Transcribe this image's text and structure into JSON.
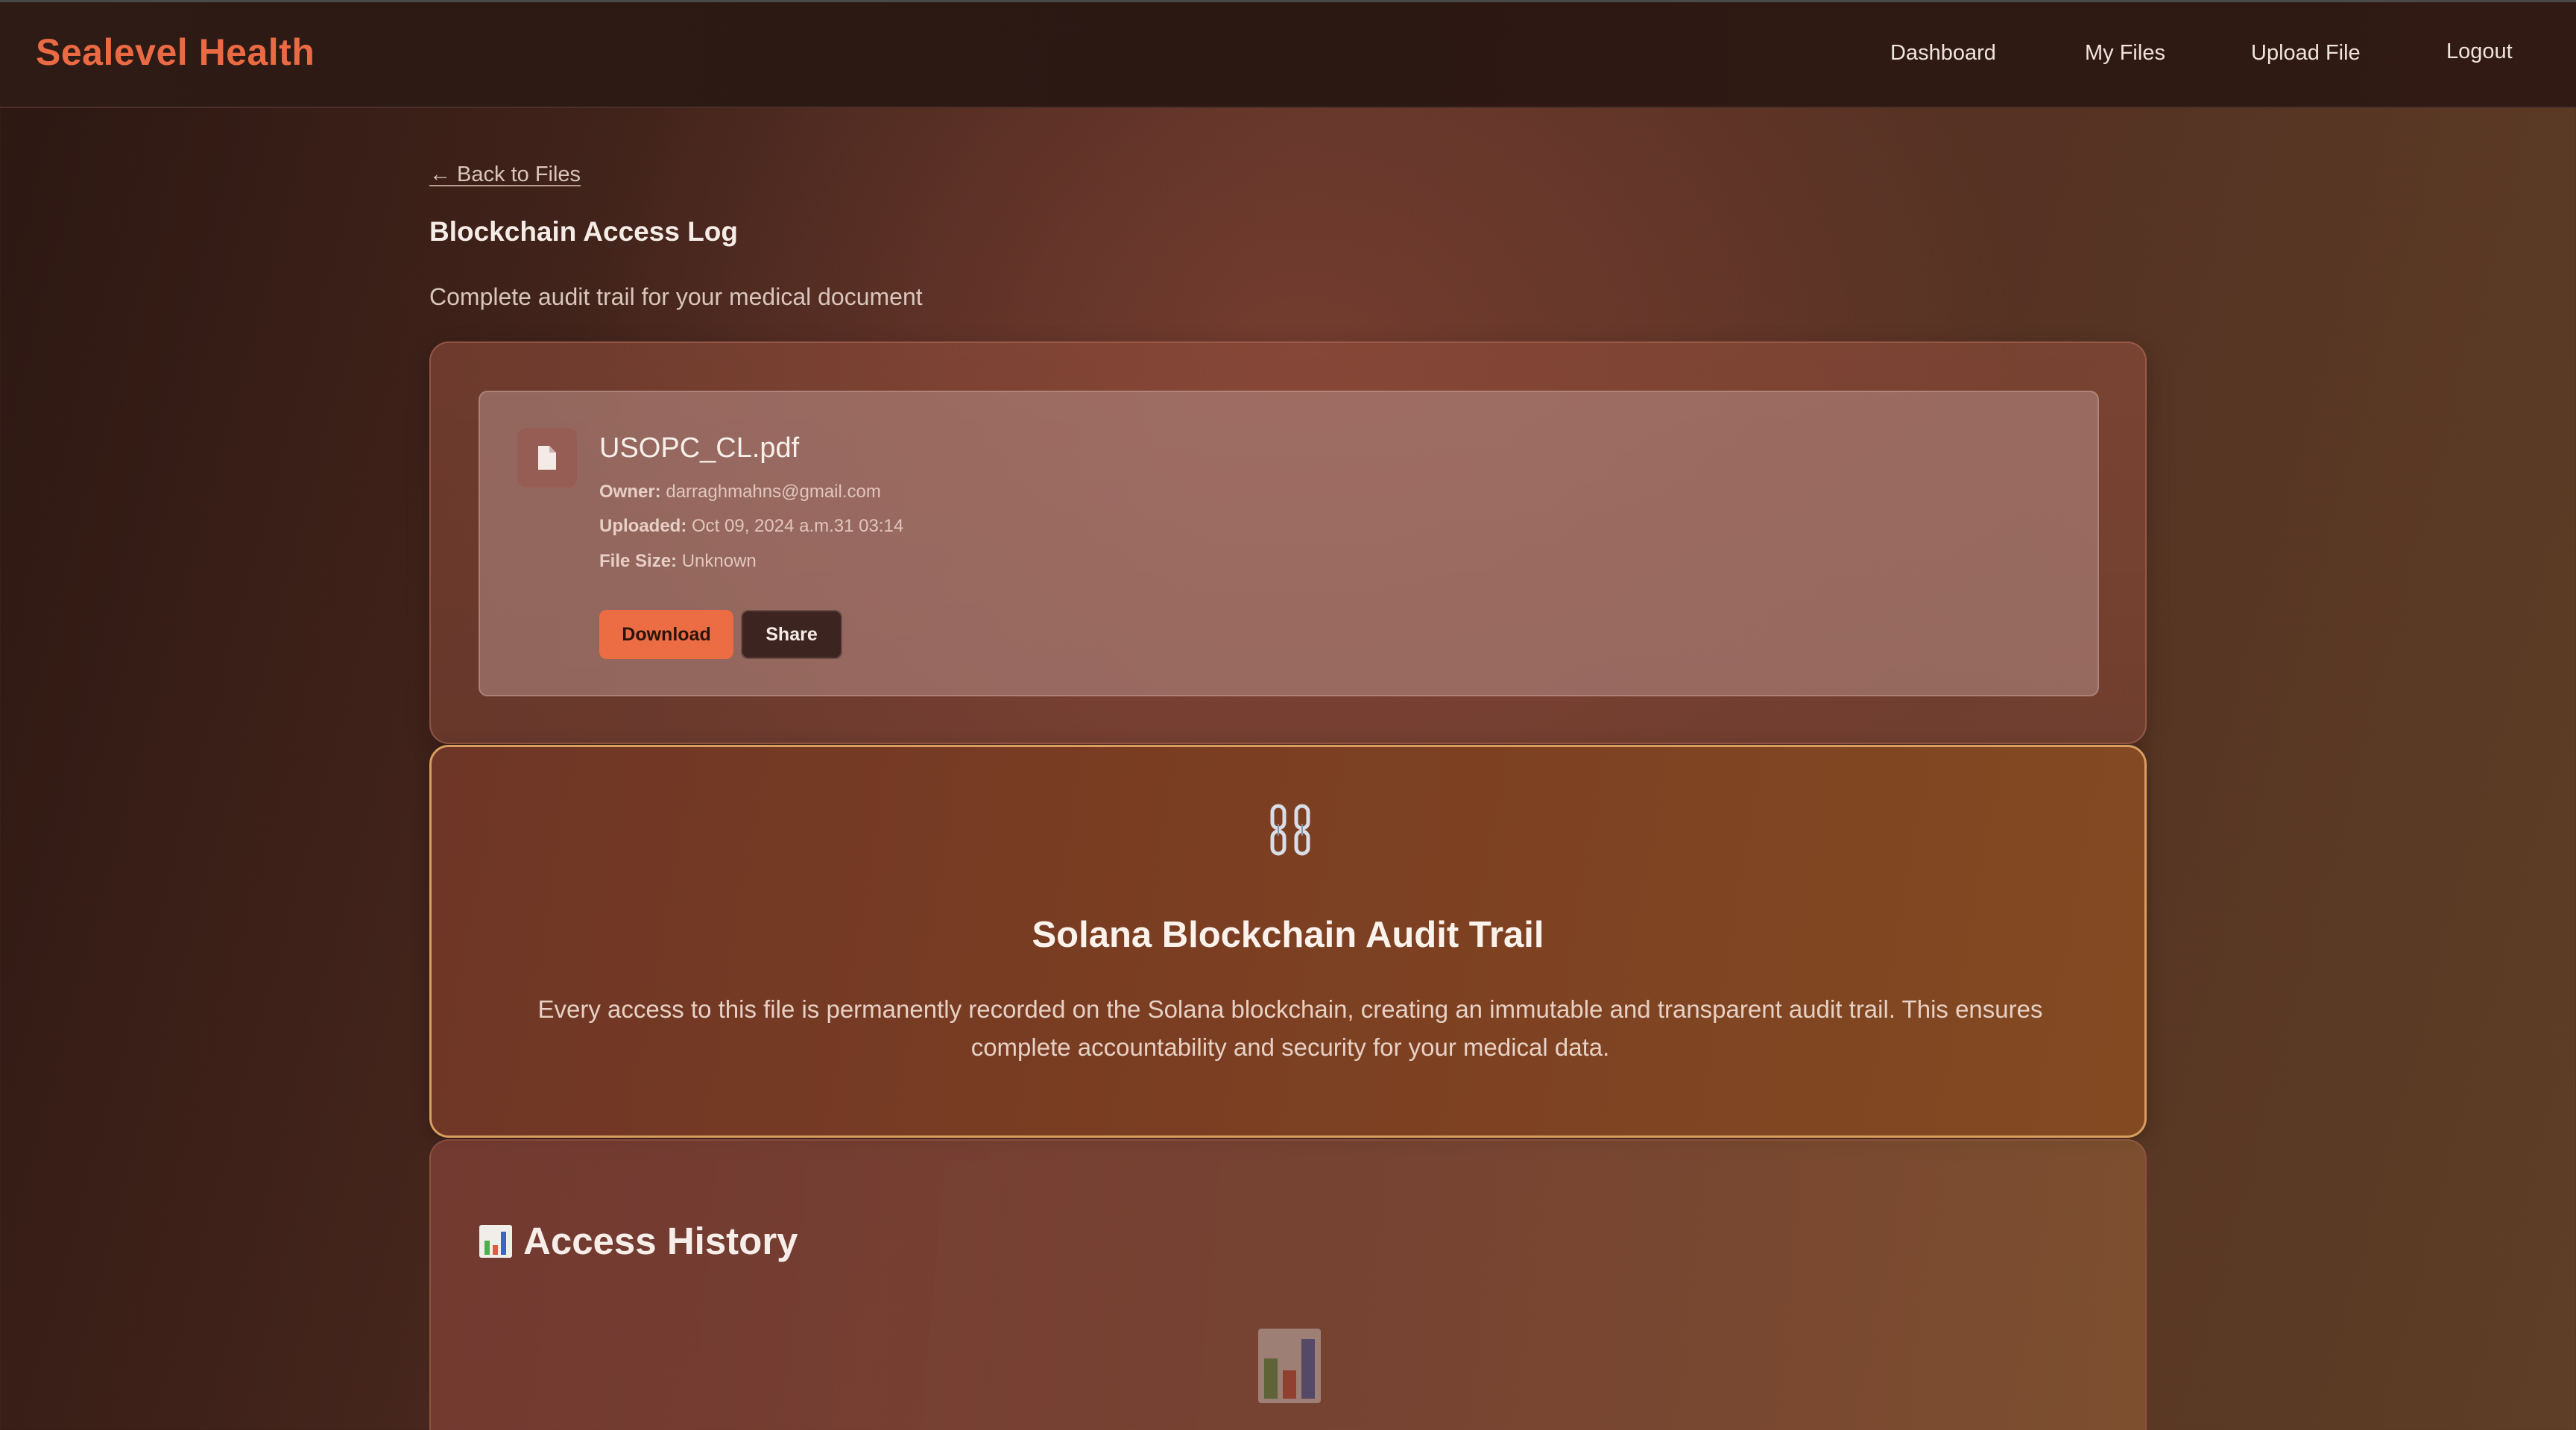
{
  "header": {
    "brand": "Sealevel Health",
    "nav": {
      "dashboard": "Dashboard",
      "my_files": "My Files",
      "upload": "Upload File",
      "logout": "Logout"
    }
  },
  "main": {
    "back_link": "← Back to Files",
    "title": "Blockchain Access Log",
    "subtitle": "Complete audit trail for your medical document"
  },
  "file": {
    "icon": "document-icon",
    "name": "USOPC_CL.pdf",
    "owner_label": "Owner:",
    "owner": "darraghmahns@gmail.com",
    "uploaded_label": "Uploaded:",
    "uploaded": "Oct 09, 2024 a.m.31 03:14",
    "size_label": "File Size:",
    "size": "Unknown",
    "download_label": "Download",
    "share_label": "Share"
  },
  "blockchain": {
    "icon": "chain-link-icon",
    "title": "Solana Blockchain Audit Trail",
    "description": "Every access to this file is permanently recorded on the Solana blockchain, creating an immutable and transparent audit trail. This ensures complete accountability and security for your medical data."
  },
  "history": {
    "icon": "bar-chart-icon",
    "title": "Access History"
  },
  "colors": {
    "brand": "#ea6a44",
    "download_button": "#ec6d43",
    "share_button": "#3c2421",
    "chain_card_border": "#d99e5f"
  }
}
